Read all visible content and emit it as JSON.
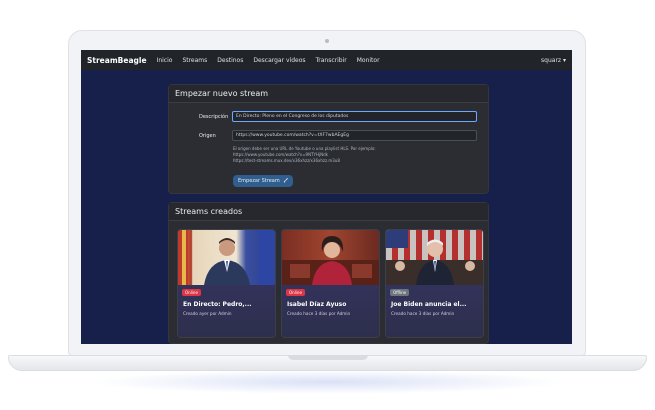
{
  "navbar": {
    "brand": "StreamBeagle",
    "items": [
      "Inicio",
      "Streams",
      "Destinos",
      "Descargar vídeos",
      "Transcribir",
      "Monitor"
    ],
    "user": "squarz ▾"
  },
  "new_stream": {
    "title": "Empezar nuevo stream",
    "description_label": "Descripción",
    "description_value": "En Directo: Pleno en el Congreso de los diputados",
    "source_label": "Origen",
    "source_value": "https://www.youtube.com/watch?v=tXF7wbAEgEg",
    "help_lines": [
      "El origen debe ser una URL de Youtube o una playlist HLS. Por ejemplo:",
      "https://www.youtube.com/watch?v=9NTYHjNdk",
      "https://test-streams.mux.dev/x36xhzz/x36xhzz.m3u8"
    ],
    "start_button": "Empezar Stream"
  },
  "streams": {
    "title": "Streams creados",
    "items": [
      {
        "status": "Online",
        "title": "En Directo: Pedro,...",
        "meta": "Creado ayer por Admin"
      },
      {
        "status": "Online",
        "title": "Isabel Díaz Ayuso",
        "meta": "Creado hace 3 días por Admin"
      },
      {
        "status": "Offline",
        "title": "Joe Biden anuncia el...",
        "meta": "Creado hace 3 días por Admin"
      }
    ]
  },
  "colors": {
    "screen_bg": "#17204a",
    "navbar_bg": "#212529",
    "card_bg": "#2b2d33",
    "online": "#dc3545",
    "offline": "#6c757d",
    "primary_button": "#2f5e8f"
  }
}
